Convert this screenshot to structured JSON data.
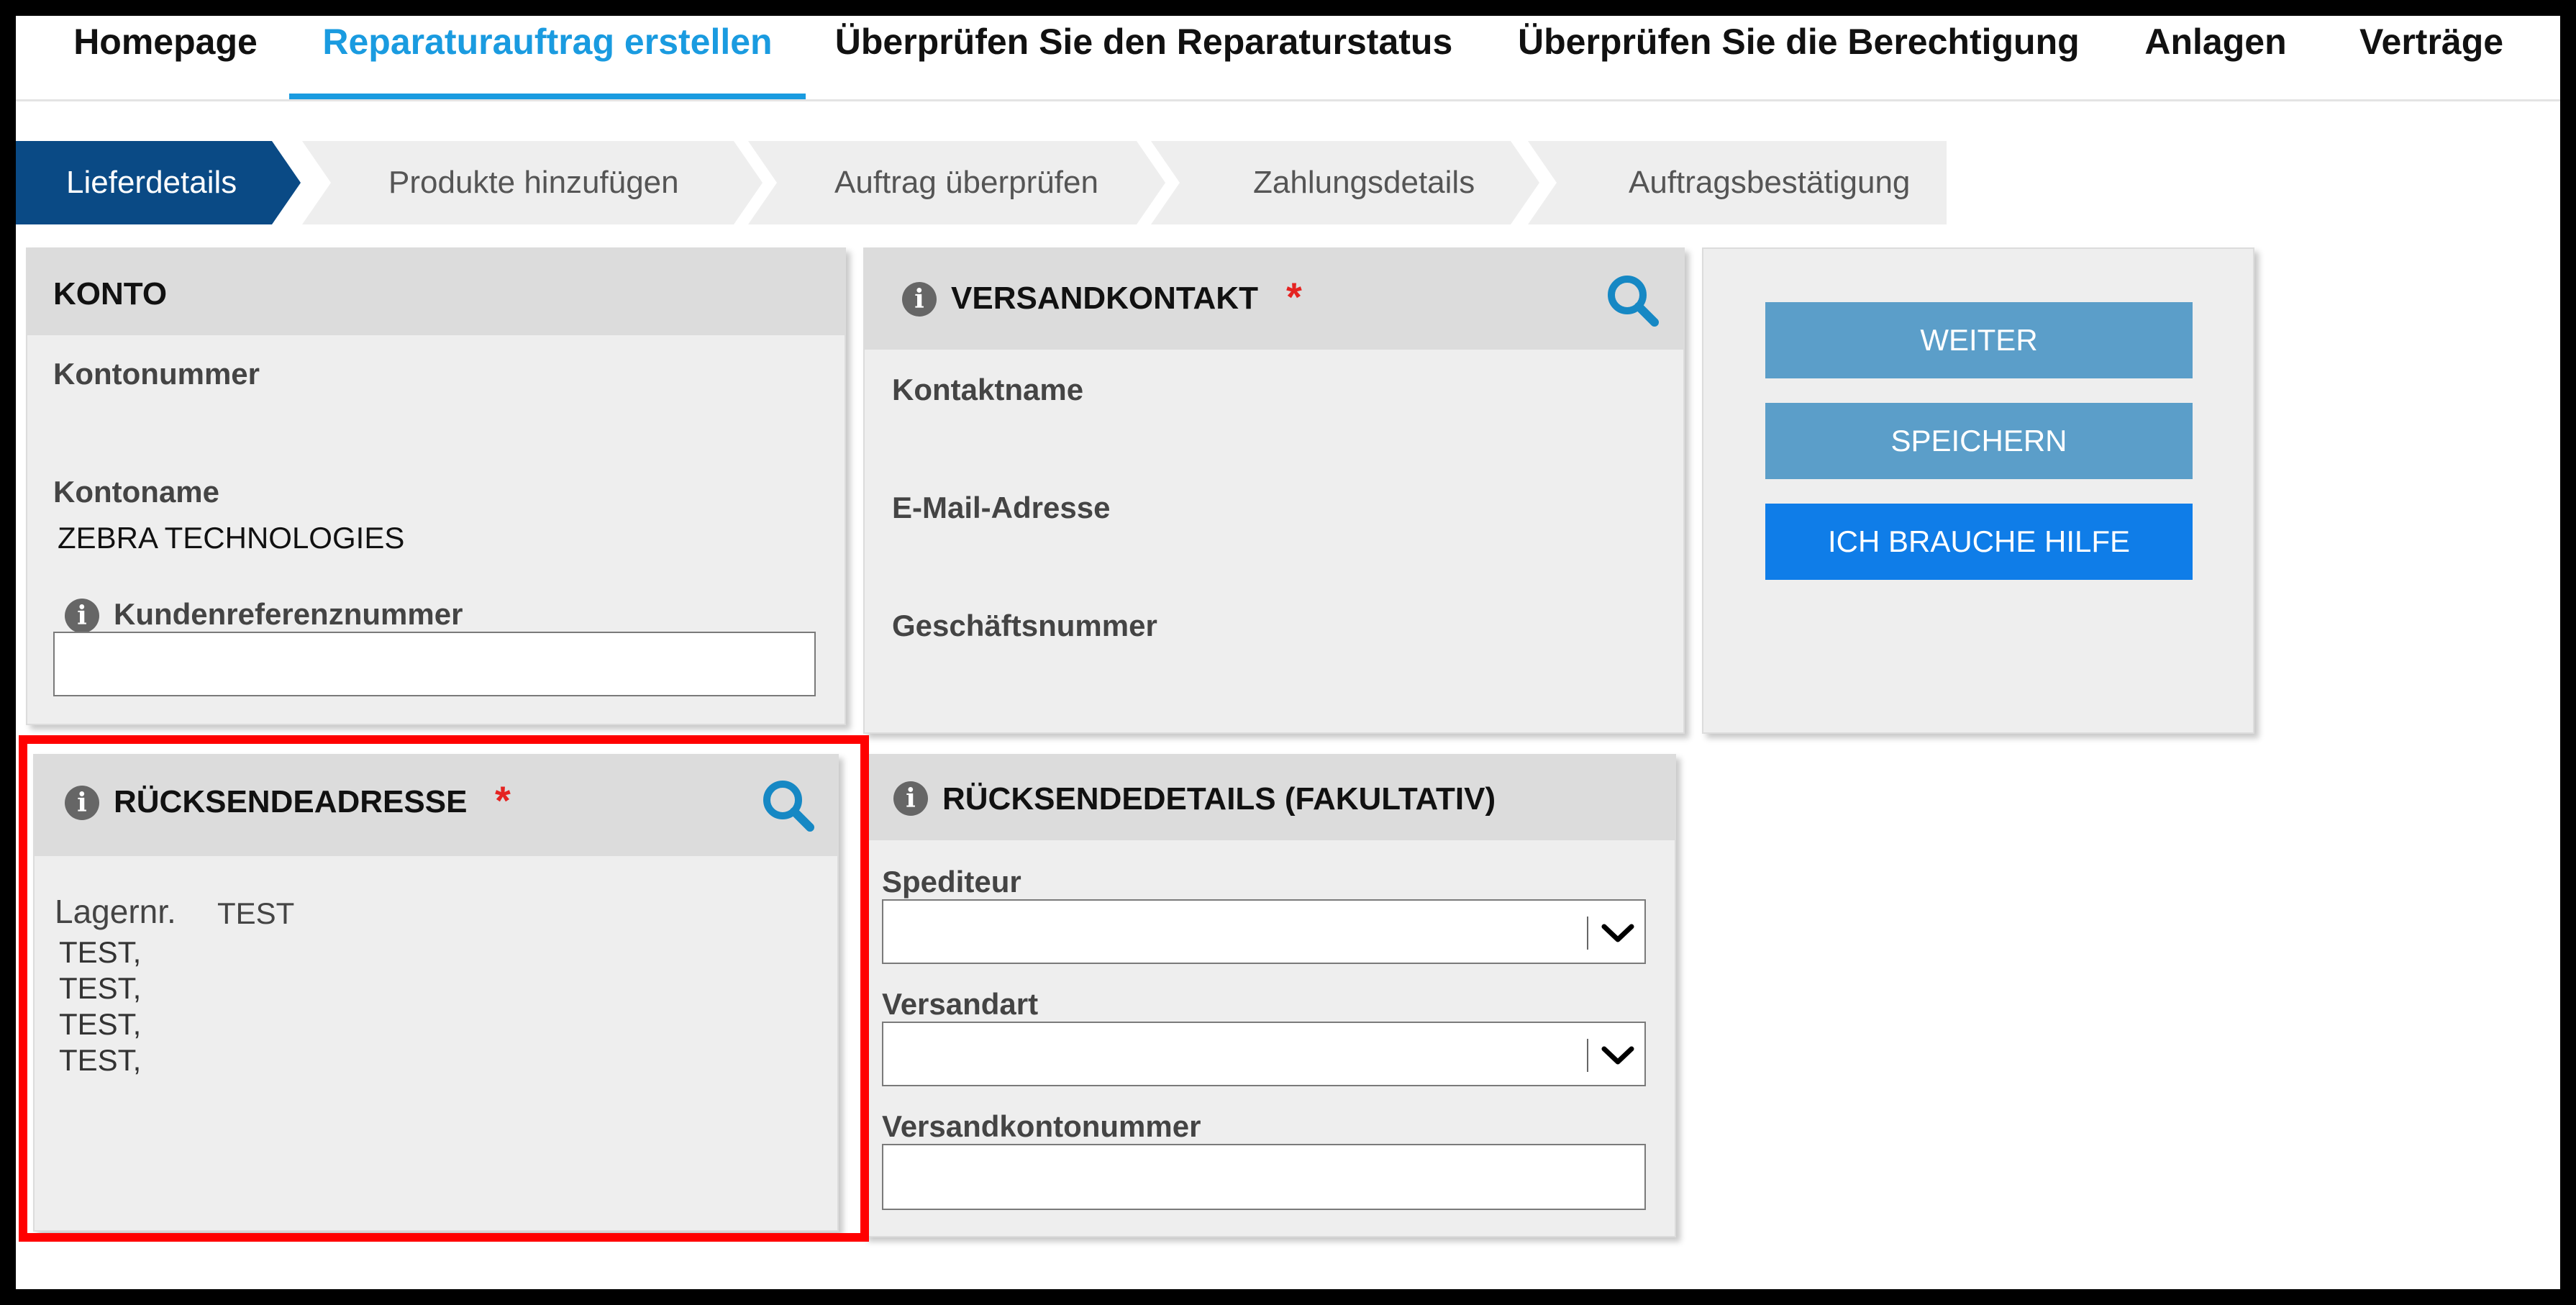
{
  "nav": {
    "items": [
      {
        "label": "Homepage",
        "active": false
      },
      {
        "label": "Reparaturauftrag erstellen",
        "active": true
      },
      {
        "label": "Überprüfen Sie den Reparaturstatus",
        "active": false
      },
      {
        "label": "Überprüfen Sie die Berechtigung",
        "active": false
      },
      {
        "label": "Anlagen",
        "active": false
      },
      {
        "label": "Verträge",
        "active": false
      }
    ]
  },
  "steps": [
    {
      "label": "Lieferdetails",
      "active": true
    },
    {
      "label": "Produkte hinzufügen",
      "active": false
    },
    {
      "label": "Auftrag überprüfen",
      "active": false
    },
    {
      "label": "Zahlungsdetails",
      "active": false
    },
    {
      "label": "Auftragsbestätigung",
      "active": false
    }
  ],
  "konto": {
    "title": "KONTO",
    "account_number_label": "Kontonummer",
    "account_number_value": "",
    "account_name_label": "Kontoname",
    "account_name_value": "ZEBRA TECHNOLOGIES",
    "customer_ref_label": "Kundenreferenznummer",
    "customer_ref_value": ""
  },
  "versandkontakt": {
    "title": "VERSANDKONTAKT",
    "required_mark": "*",
    "contact_name_label": "Kontaktname",
    "email_label": "E-Mail-Adresse",
    "business_number_label": "Geschäftsnummer"
  },
  "actions": {
    "continue_label": "WEITER",
    "save_label": "SPEICHERN",
    "help_label": "ICH BRAUCHE HILFE"
  },
  "ruecksendeadresse": {
    "title": "RÜCKSENDEADRESSE",
    "required_mark": "*",
    "warehouse_label": "Lagernr.",
    "warehouse_value": "TEST",
    "address_lines": [
      "TEST,",
      "TEST,",
      "TEST,",
      "TEST,"
    ]
  },
  "ruecksendedetails": {
    "title": "RÜCKSENDEDETAILS (FAKULTATIV)",
    "carrier_label": "Spediteur",
    "carrier_value": "",
    "shipping_method_label": "Versandart",
    "shipping_method_value": "",
    "shipping_account_label": "Versandkontonummer",
    "shipping_account_value": ""
  },
  "colors": {
    "accent": "#1a9be0",
    "step_active": "#0a4a85",
    "step_inactive": "#eeeeee",
    "button_light": "#5b9ec9",
    "button_primary": "#0f7de8",
    "required": "#e52321",
    "highlight_box": "#ff0000"
  },
  "icons": {
    "info": "info-circle-icon",
    "search": "search-icon",
    "dropdown": "chevron-down-icon"
  }
}
